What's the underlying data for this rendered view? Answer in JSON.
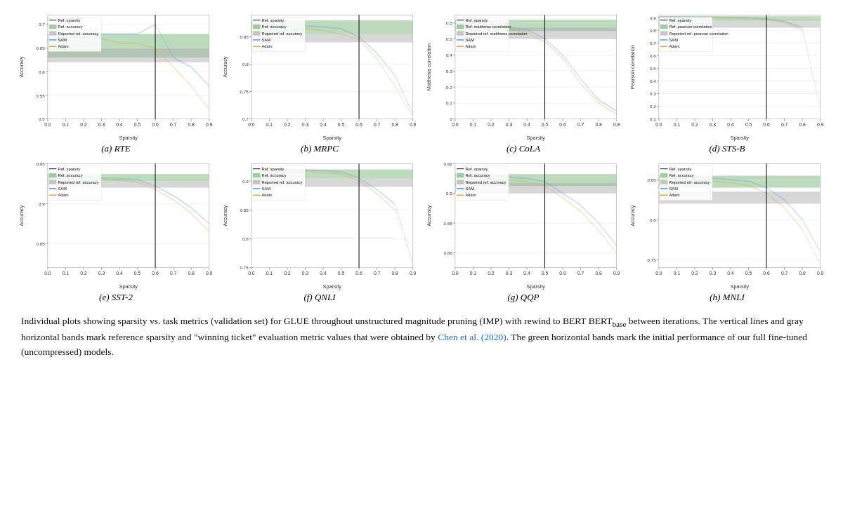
{
  "plots": [
    {
      "id": "rte",
      "label": "(a) RTE",
      "yLabel": "Accuracy",
      "xLabel": "Sparsity",
      "yMin": 0.5,
      "yMax": 0.72,
      "refSparsity": 0.6,
      "refAccMin": 0.63,
      "refAccMax": 0.68,
      "reportedMin": 0.62,
      "reportedMax": 0.65,
      "sam": [
        0.68,
        0.68,
        0.68,
        0.68,
        0.68,
        0.68,
        0.7,
        0.63,
        0.61,
        0.57
      ],
      "adam": [
        0.67,
        0.67,
        0.67,
        0.67,
        0.66,
        0.66,
        0.65,
        0.61,
        0.57,
        0.52
      ],
      "legend": [
        "Ref. sparsity",
        "Ref. accuracy",
        "Reported ref. accuracy",
        "SAM",
        "Adam"
      ]
    },
    {
      "id": "mrpc",
      "label": "(b) MRPC",
      "yLabel": "Accuracy",
      "xLabel": "Sparsity",
      "yMin": 0.7,
      "yMax": 0.89,
      "refSparsity": 0.6,
      "refAccMin": 0.855,
      "refAccMax": 0.88,
      "reportedMin": 0.84,
      "reportedMax": 0.855,
      "sam": [
        0.875,
        0.873,
        0.872,
        0.87,
        0.868,
        0.865,
        0.85,
        0.82,
        0.78,
        0.71
      ],
      "adam": [
        0.872,
        0.87,
        0.868,
        0.865,
        0.862,
        0.855,
        0.845,
        0.81,
        0.76,
        0.705
      ],
      "legend": [
        "Ref. sparsity",
        "Ref. accuracy",
        "Reported ref. accuracy",
        "SAM",
        "Adam"
      ]
    },
    {
      "id": "cola",
      "label": "(c) CoLA",
      "yLabel": "Matthews correlation",
      "xLabel": "Sparsity",
      "yMin": 0.0,
      "yMax": 0.65,
      "refSparsity": 0.5,
      "refAccMin": 0.55,
      "refAccMax": 0.62,
      "reportedMin": 0.5,
      "reportedMax": 0.57,
      "sam": [
        0.6,
        0.59,
        0.58,
        0.57,
        0.56,
        0.5,
        0.4,
        0.25,
        0.12,
        0.05
      ],
      "adam": [
        0.59,
        0.58,
        0.57,
        0.56,
        0.54,
        0.48,
        0.38,
        0.22,
        0.1,
        0.03
      ],
      "legend": [
        "Ref. sparsity",
        "Ref. matthews correlation",
        "Reported ref. matthews correlation",
        "SAM",
        "Adam"
      ]
    },
    {
      "id": "stsb",
      "label": "(d) STS-B",
      "yLabel": "Pearson correlation",
      "xLabel": "Sparsity",
      "yMin": 0.1,
      "yMax": 0.92,
      "refSparsity": 0.6,
      "refAccMin": 0.87,
      "refAccMax": 0.91,
      "reportedMin": 0.82,
      "reportedMax": 0.87,
      "sam": [
        0.905,
        0.904,
        0.903,
        0.902,
        0.9,
        0.898,
        0.89,
        0.87,
        0.82,
        0.2
      ],
      "adam": [
        0.902,
        0.901,
        0.9,
        0.898,
        0.896,
        0.892,
        0.885,
        0.86,
        0.8,
        0.15
      ],
      "legend": [
        "Ref. sparsity",
        "Ref. pearson correlation",
        "Reported ref. pearson correlation",
        "SAM",
        "Adam"
      ]
    },
    {
      "id": "sst2",
      "label": "(e) SST-2",
      "yLabel": "Accuracy",
      "xLabel": "Sparsity",
      "yMin": 0.82,
      "yMax": 0.95,
      "refSparsity": 0.6,
      "refAccMin": 0.928,
      "refAccMax": 0.937,
      "reportedMin": 0.92,
      "reportedMax": 0.928,
      "sam": [
        0.935,
        0.934,
        0.933,
        0.932,
        0.931,
        0.93,
        0.922,
        0.91,
        0.895,
        0.875
      ],
      "adam": [
        0.933,
        0.932,
        0.931,
        0.93,
        0.929,
        0.927,
        0.918,
        0.905,
        0.888,
        0.865
      ],
      "legend": [
        "Ref. sparsity",
        "Ref. accuracy",
        "Reported ref. accuracy",
        "SAM",
        "Adam"
      ]
    },
    {
      "id": "qnli",
      "label": "(f) QNLI",
      "yLabel": "Accuracy",
      "xLabel": "Sparsity",
      "yMin": 0.75,
      "yMax": 0.93,
      "refSparsity": 0.6,
      "refAccMin": 0.905,
      "refAccMax": 0.92,
      "reportedMin": 0.89,
      "reportedMax": 0.905,
      "sam": [
        0.922,
        0.921,
        0.92,
        0.919,
        0.918,
        0.916,
        0.905,
        0.885,
        0.86,
        0.76
      ],
      "adam": [
        0.92,
        0.919,
        0.918,
        0.917,
        0.915,
        0.912,
        0.9,
        0.878,
        0.85,
        0.755
      ],
      "legend": [
        "Ref. sparsity",
        "Ref. accuracy",
        "Reported ref. accuracy",
        "SAM",
        "Adam"
      ]
    },
    {
      "id": "qqp",
      "label": "(g) QQP",
      "yLabel": "Accuracy",
      "xLabel": "Sparsity",
      "yMin": 0.85,
      "yMax": 0.92,
      "refSparsity": 0.5,
      "refAccMin": 0.905,
      "refAccMax": 0.913,
      "reportedMin": 0.9,
      "reportedMax": 0.907,
      "sam": [
        0.913,
        0.912,
        0.912,
        0.911,
        0.91,
        0.908,
        0.9,
        0.892,
        0.88,
        0.865
      ],
      "adam": [
        0.911,
        0.91,
        0.91,
        0.909,
        0.908,
        0.905,
        0.897,
        0.888,
        0.875,
        0.86
      ],
      "legend": [
        "Ref. sparsity",
        "Ref. accuracy",
        "Reported ref. accuracy",
        "SAM",
        "Adam"
      ]
    },
    {
      "id": "mnli",
      "label": "(h) MNLI",
      "yLabel": "Accuracy",
      "xLabel": "Sparsity",
      "yMin": 0.74,
      "yMax": 0.87,
      "refSparsity": 0.6,
      "refAccMin": 0.84,
      "refAccMax": 0.855,
      "reportedMin": 0.82,
      "reportedMax": 0.835,
      "sam": [
        0.855,
        0.854,
        0.853,
        0.852,
        0.85,
        0.848,
        0.84,
        0.825,
        0.8,
        0.76
      ],
      "adam": [
        0.852,
        0.851,
        0.85,
        0.848,
        0.846,
        0.843,
        0.833,
        0.815,
        0.788,
        0.745
      ],
      "legend": [
        "Ref. sparsity",
        "Ref. accuracy",
        "Reported ref. accuracy",
        "SAM",
        "Adam"
      ]
    }
  ],
  "caption": {
    "text1": "Individual plots showing sparsity vs. task metrics (validation set) for GLUE throughout unstructured magnitude pruning (IMP) with rewind to BERT",
    "bertSub": "base",
    "text2": " between iterations. The vertical lines and gray horizontal bands mark reference sparsity and \"winning ticket\" evaluation metric values that were obtained by ",
    "citation": "Chen et al. (2020)",
    "text3": ". The green horizontal bands mark the initial performance of our full fine-tuned (uncompressed) models."
  },
  "colors": {
    "sam": "#5ba3c9",
    "adam": "#e8a44a",
    "refAcc": "#7ab87a",
    "reportedAcc": "#b0b0b0",
    "refLine": "#222222"
  }
}
